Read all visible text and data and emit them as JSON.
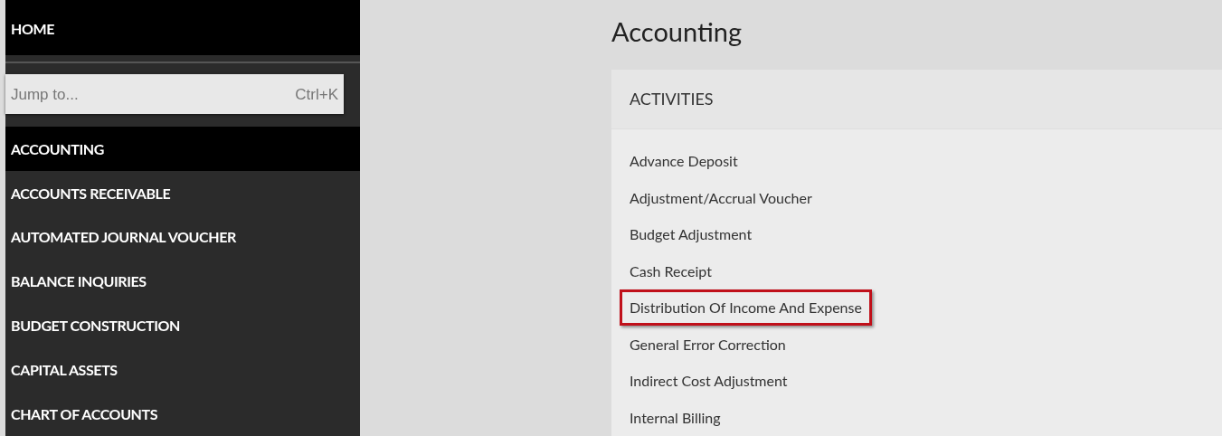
{
  "sidebar": {
    "home": "HOME",
    "search": {
      "placeholder": "Jump to...",
      "shortcut": "Ctrl+K"
    },
    "items": [
      {
        "label": "ACCOUNTING",
        "selected": true
      },
      {
        "label": "ACCOUNTS RECEIVABLE",
        "selected": false
      },
      {
        "label": "AUTOMATED JOURNAL VOUCHER",
        "selected": false
      },
      {
        "label": "BALANCE INQUIRIES",
        "selected": false
      },
      {
        "label": "BUDGET CONSTRUCTION",
        "selected": false
      },
      {
        "label": "CAPITAL ASSETS",
        "selected": false
      },
      {
        "label": "CHART OF ACCOUNTS",
        "selected": false
      }
    ]
  },
  "page": {
    "title": "Accounting",
    "card": {
      "heading": "ACTIVITIES",
      "links": [
        {
          "label": "Advance Deposit",
          "highlighted": false
        },
        {
          "label": "Adjustment/Accrual Voucher",
          "highlighted": false
        },
        {
          "label": "Budget Adjustment",
          "highlighted": false
        },
        {
          "label": "Cash Receipt",
          "highlighted": false
        },
        {
          "label": "Distribution Of Income And Expense",
          "highlighted": true
        },
        {
          "label": "General Error Correction",
          "highlighted": false
        },
        {
          "label": "Indirect Cost Adjustment",
          "highlighted": false
        },
        {
          "label": "Internal Billing",
          "highlighted": false
        }
      ]
    }
  }
}
